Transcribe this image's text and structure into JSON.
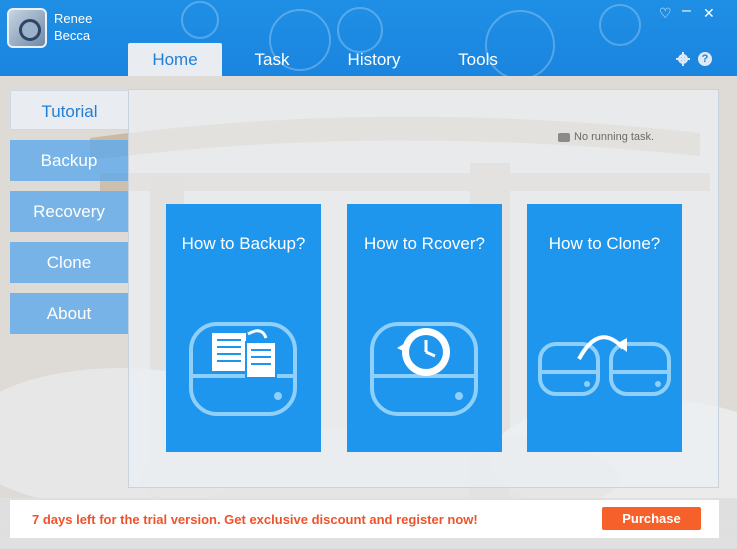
{
  "app": {
    "name_line1": "Renee",
    "name_line2": "Becca"
  },
  "tabs": [
    {
      "label": "Home"
    },
    {
      "label": "Task"
    },
    {
      "label": "History"
    },
    {
      "label": "Tools"
    }
  ],
  "nav": [
    {
      "label": "Tutorial"
    },
    {
      "label": "Backup"
    },
    {
      "label": "Recovery"
    },
    {
      "label": "Clone"
    },
    {
      "label": "About"
    }
  ],
  "status": {
    "text": "No running task."
  },
  "cards": [
    {
      "title": "How to Backup?",
      "icon": "backup-drive-icon"
    },
    {
      "title": "How to Rcover?",
      "icon": "restore-clock-icon"
    },
    {
      "title": "How to Clone?",
      "icon": "clone-drives-icon"
    }
  ],
  "footer": {
    "trial_text": "7 days left for the trial version. Get exclusive discount and register now!",
    "purchase_label": "Purchase"
  },
  "colors": {
    "brand_blue": "#1f8fe5",
    "card_blue": "#1e96ee",
    "purchase_orange": "#f5602b",
    "trial_text": "#f0522a"
  }
}
